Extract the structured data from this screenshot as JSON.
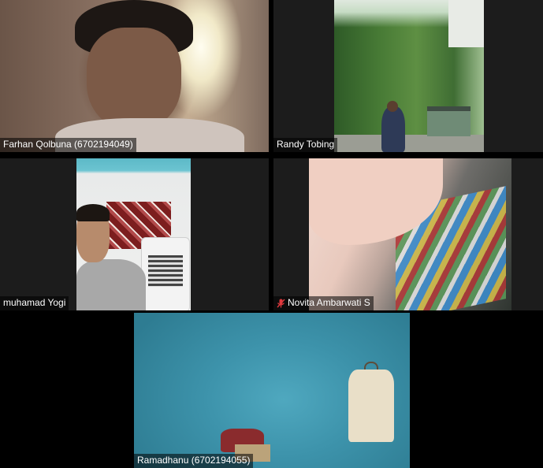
{
  "app": {
    "view": "gallery"
  },
  "colors": {
    "active_speaker_border": "#9dd85a",
    "background": "#000000"
  },
  "participants": [
    {
      "name": "Farhan Qolbuna (6702194049)",
      "muted": false,
      "active_speaker": false
    },
    {
      "name": "Randy Tobing",
      "muted": false,
      "active_speaker": false
    },
    {
      "name": "muhamad Yogi",
      "muted": false,
      "active_speaker": false
    },
    {
      "name": "Novita Ambarwati S",
      "muted": true,
      "icon": "muted-mic-icon",
      "active_speaker": false
    },
    {
      "name": "Ramadhanu (6702194055)",
      "muted": false,
      "active_speaker": true
    }
  ]
}
